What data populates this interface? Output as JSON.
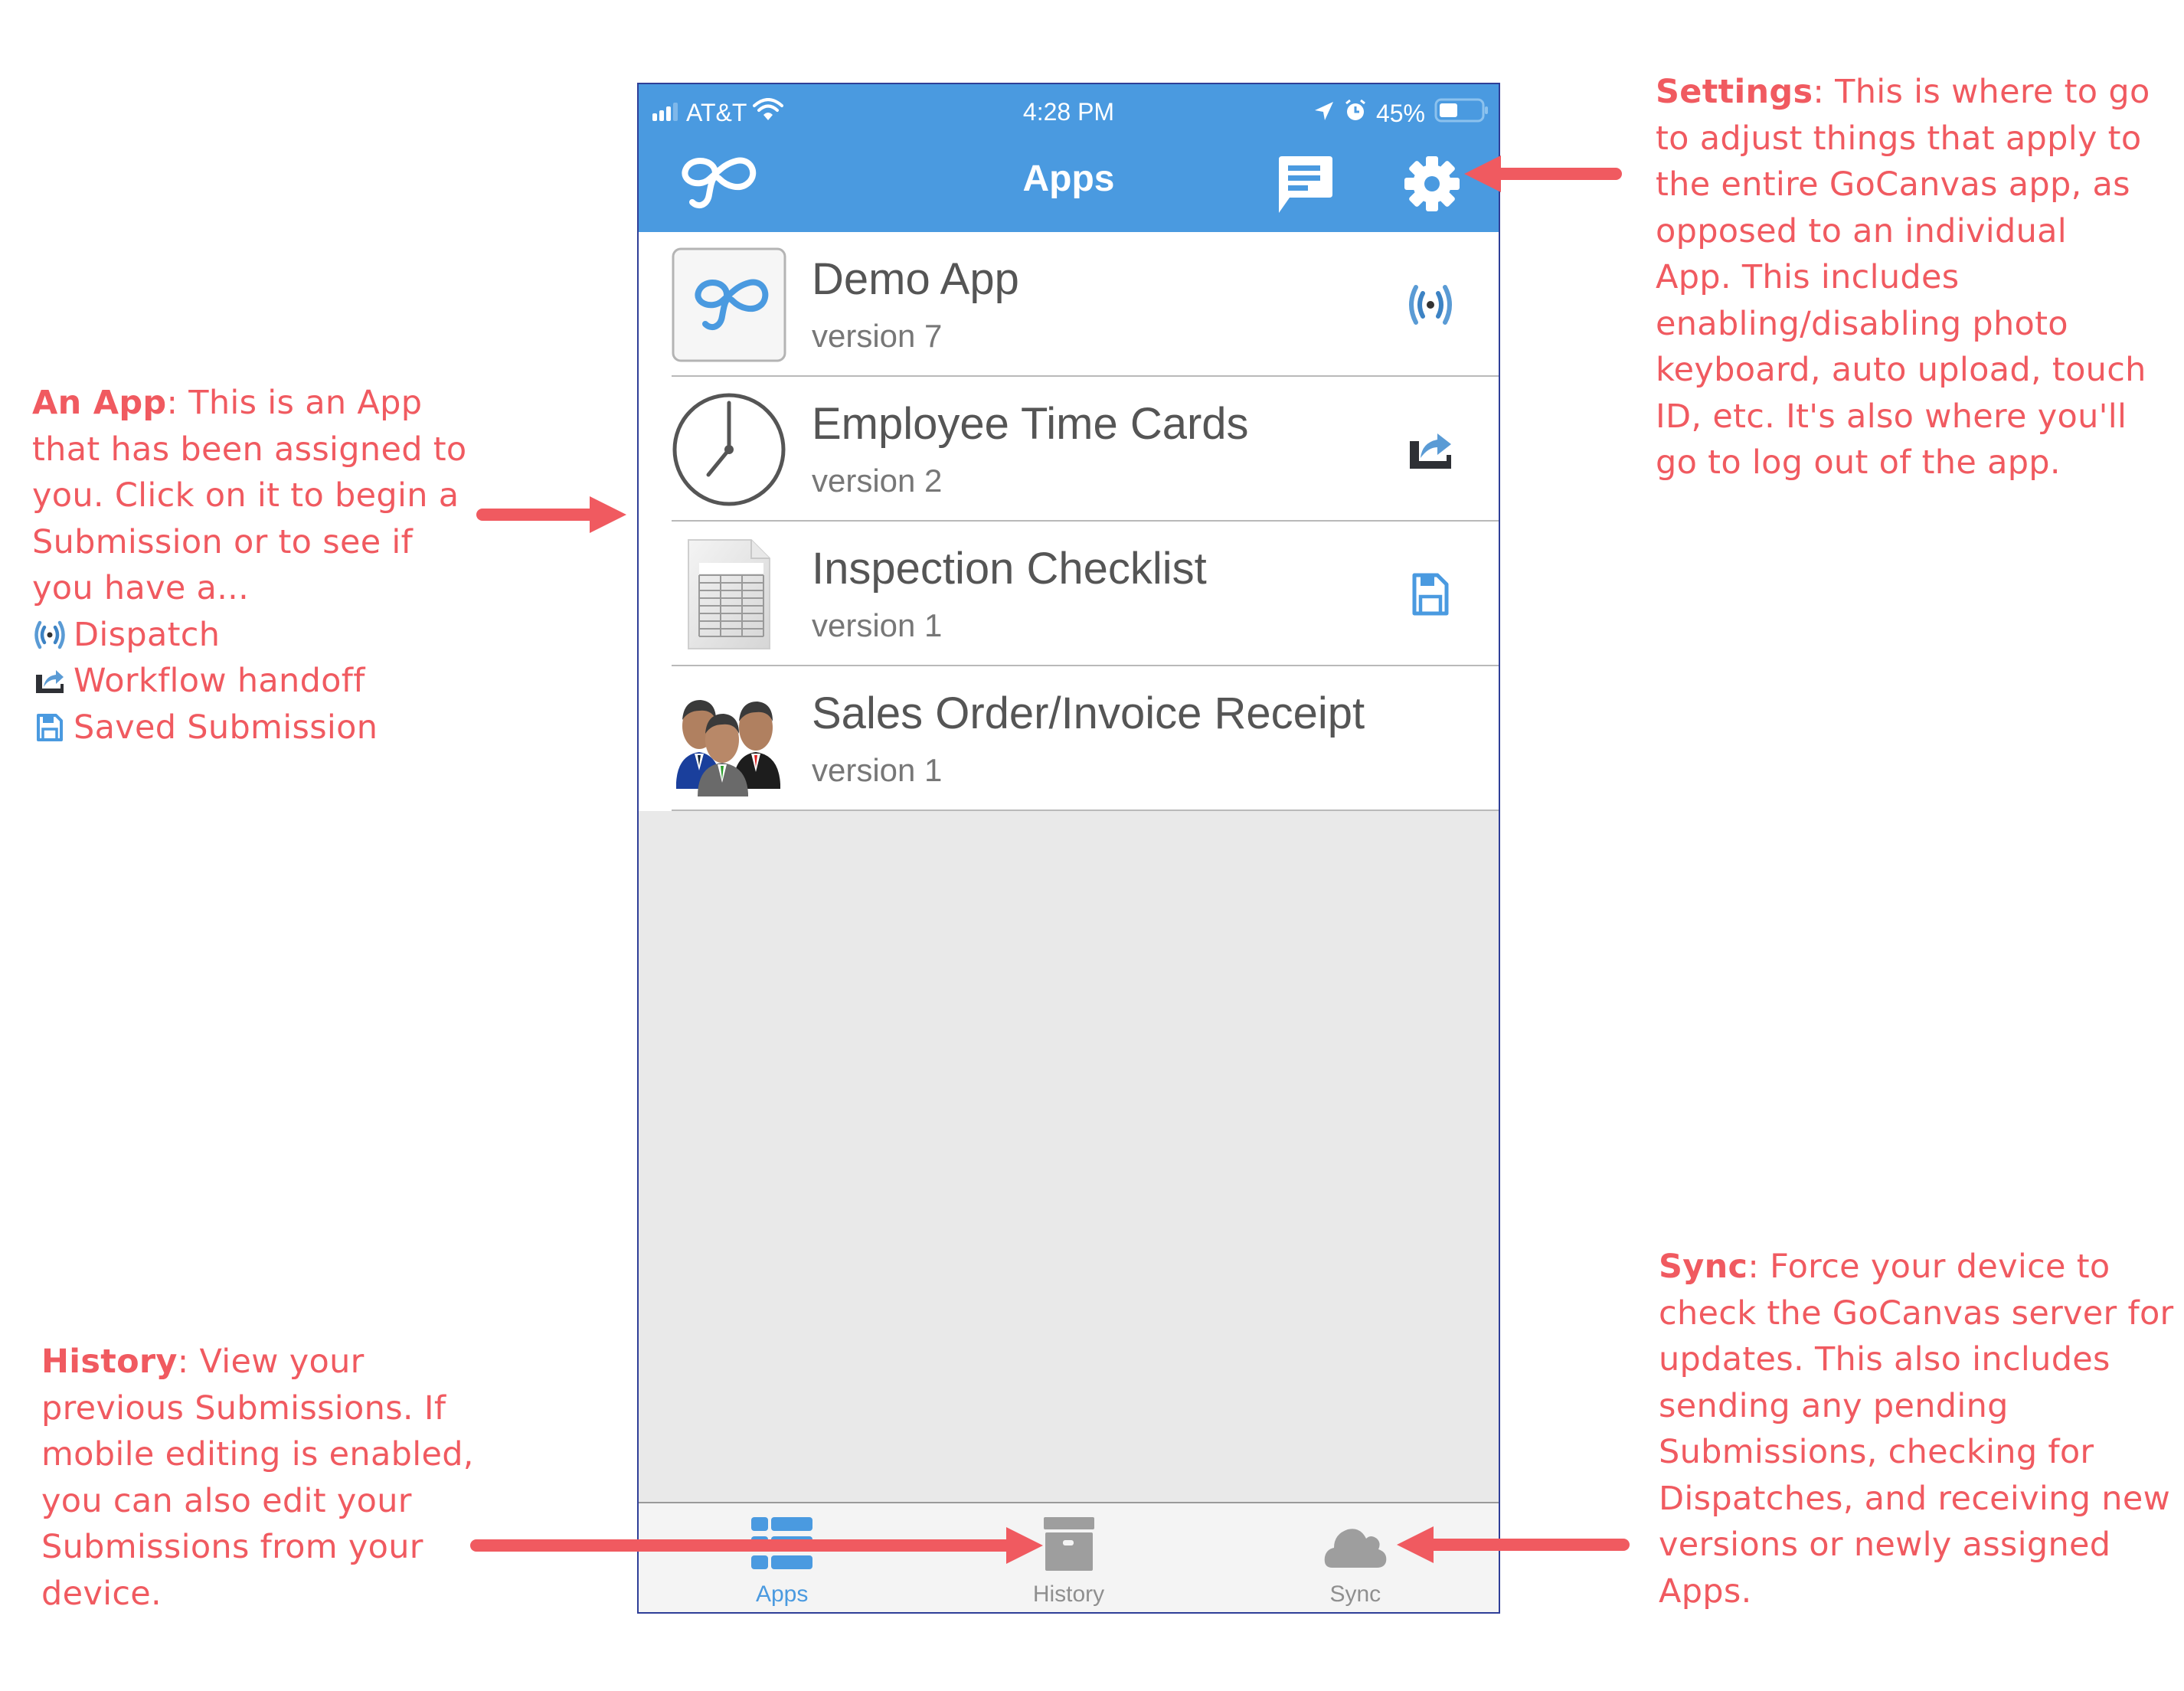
{
  "status_bar": {
    "carrier": "AT&T",
    "time": "4:28 PM",
    "battery_percent_label": "45%",
    "battery_level": 0.45,
    "icons": [
      "signal-icon",
      "wifi-icon",
      "location-arrow-icon",
      "alarm-icon",
      "battery-icon"
    ]
  },
  "navbar": {
    "logo": "gocanvas-logo-icon",
    "title": "Apps",
    "actions": [
      {
        "name": "messages",
        "icon": "chat-icon"
      },
      {
        "name": "settings",
        "icon": "gear-icon"
      }
    ]
  },
  "apps": [
    {
      "title": "Demo App",
      "version": "version 7",
      "thumb": "gocanvas-logo-icon",
      "status": "dispatch",
      "status_icon": "dispatch-broadcast-icon"
    },
    {
      "title": "Employee Time Cards",
      "version": "version 2",
      "thumb": "clock-icon",
      "status": "workflow handoff",
      "status_icon": "workflow-handoff-icon"
    },
    {
      "title": "Inspection Checklist",
      "version": "version 1",
      "thumb": "spreadsheet-document-icon",
      "status": "saved submission",
      "status_icon": "floppy-disk-icon"
    },
    {
      "title": "Sales Order/Invoice Receipt",
      "version": "version 1",
      "thumb": "business-people-icon",
      "status": null,
      "status_icon": null
    }
  ],
  "tabbar": {
    "tabs": [
      {
        "label": "Apps",
        "icon": "apps-list-icon",
        "active": true
      },
      {
        "label": "History",
        "icon": "archive-box-icon",
        "active": false
      },
      {
        "label": "Sync",
        "icon": "cloud-icon",
        "active": false
      }
    ]
  },
  "annotations": {
    "color": "#f05a60",
    "app": {
      "heading": "An App",
      "lines": [
        ": This is an App",
        "that has been assigned to",
        "you. Click on it to begin a",
        "Submission or to see if",
        "you have a..."
      ],
      "legend": [
        {
          "icon": "dispatch-broadcast-icon",
          "label": "Dispatch"
        },
        {
          "icon": "workflow-handoff-icon",
          "label": "Workflow handoff"
        },
        {
          "icon": "floppy-disk-icon",
          "label": "Saved Submission"
        }
      ]
    },
    "settings": {
      "heading": "Settings",
      "lines": [
        ": This is where to go",
        "to adjust things that apply to",
        "the entire GoCanvas app, as",
        "opposed to an individual",
        "App. This includes",
        "enabling/disabling photo",
        "keyboard, auto upload, touch",
        "ID, etc. It's also where you'll",
        "go to log out of the app."
      ]
    },
    "history": {
      "heading": "History",
      "lines": [
        ": View your",
        "previous Submissions. If",
        "mobile editing is enabled,",
        "you can also edit your",
        "Submissions from your",
        "device."
      ]
    },
    "sync": {
      "heading": "Sync",
      "lines": [
        ": Force your device to",
        "check the GoCanvas server for",
        "updates. This also includes",
        "sending any pending",
        "Submissions, checking for",
        "Dispatches, and receiving new",
        "versions or newly assigned",
        "Apps."
      ]
    }
  },
  "colors": {
    "brand_blue": "#4a9ae0",
    "annotation_red": "#f05a60",
    "list_bg": "#e9e9e9",
    "tabbar_bg": "#f4f4f4",
    "inactive_gray": "#9e9e9e"
  }
}
